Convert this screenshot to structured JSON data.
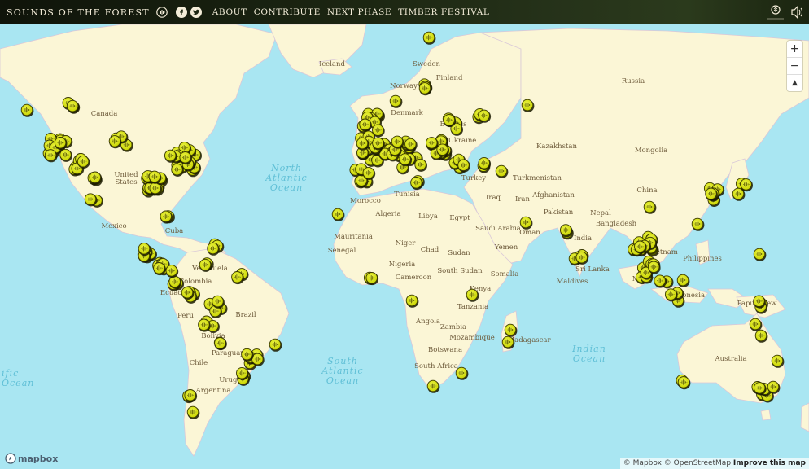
{
  "header": {
    "title": "SOUNDS OF THE FOREST",
    "nav": [
      "ABOUT",
      "CONTRIBUTE",
      "NEXT PHASE",
      "TIMBER FESTIVAL"
    ],
    "icons": [
      "audio-icon",
      "facebook-icon",
      "twitter-icon",
      "forest-logo-icon",
      "sound-toggle-icon"
    ]
  },
  "controls": {
    "zoom_in": "+",
    "zoom_out": "−",
    "compass": "▲"
  },
  "attribution": {
    "mapbox": "© Mapbox",
    "osm": "© OpenStreetMap",
    "improve": "Improve this map"
  },
  "logo_text": "mapbox",
  "labels": {
    "countries": [
      "Canada",
      "United States",
      "Mexico",
      "Cuba",
      "Venezuela",
      "Colombia",
      "Ecuador",
      "Peru",
      "Brazil",
      "Bolivia",
      "Paraguay",
      "Chile",
      "Argentina",
      "Uruguay",
      "Iceland",
      "Norway",
      "Sweden",
      "Finland",
      "Denmark",
      "Belarus",
      "Ukraine",
      "Turkey",
      "Russia",
      "Kazakhstan",
      "Mongolia",
      "China",
      "Turkmenistan",
      "Afghanistan",
      "Iran",
      "Iraq",
      "Pakistan",
      "Nepal",
      "India",
      "Bangladesh",
      "Vietnam",
      "Philippines",
      "Malaysia",
      "Indonesia",
      "Papua New Guinea",
      "Sri Lanka",
      "Maldives",
      "Saudi Arabia",
      "Oman",
      "Yemen",
      "Egypt",
      "Libya",
      "Tunisia",
      "Algeria",
      "Morocco",
      "Mauritania",
      "Senegal",
      "Niger",
      "Chad",
      "Sudan",
      "South Sudan",
      "Nigeria",
      "Cameroon",
      "Somalia",
      "Kenya",
      "Tanzania",
      "Angola",
      "Zambia",
      "Mozambique",
      "Botswana",
      "South Africa",
      "Madagascar",
      "Australia"
    ],
    "oceans": [
      "North Atlantic Ocean",
      "South Atlantic Ocean",
      "Indian Ocean",
      "Pacific Ocean"
    ]
  },
  "colors": {
    "ocean": "#a9e6f2",
    "land": "#fbf6d6",
    "border": "#c9b8d0",
    "marker": "#d5e000",
    "marker_ring": "#2b2b00",
    "label": "#6d5a3a",
    "ocean_label": "#5fbfd6"
  },
  "marker_count": 300,
  "marker_icon": "sound-wave-icon"
}
